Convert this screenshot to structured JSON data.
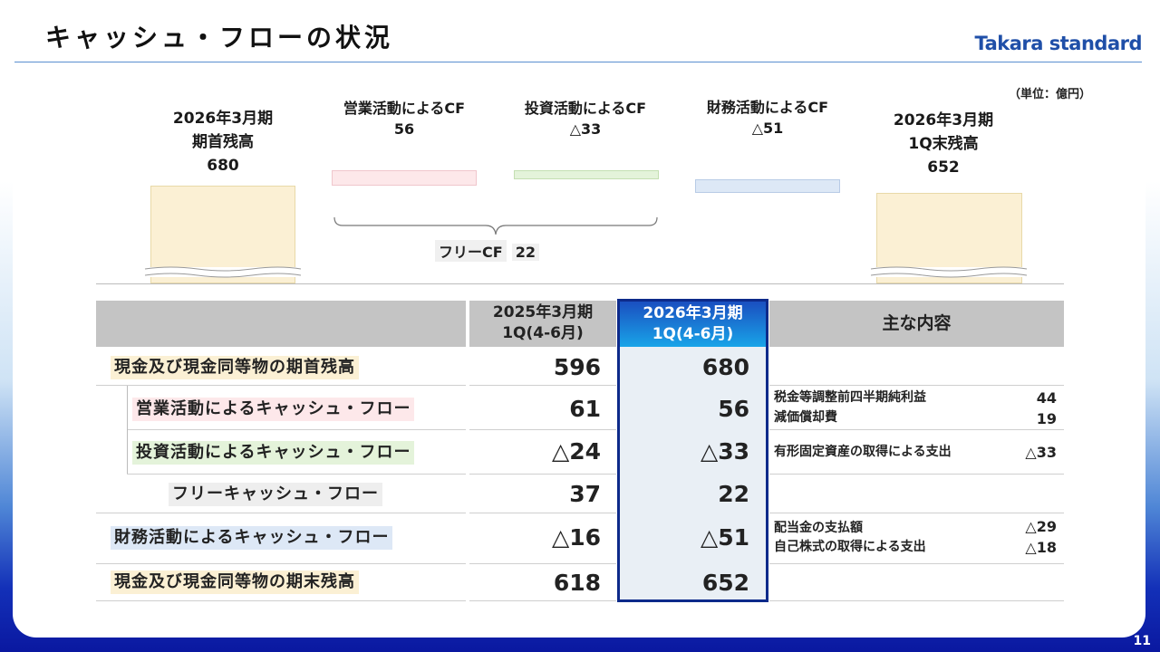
{
  "header": {
    "title": "キャッシュ・フローの状況",
    "logo": "Takara standard",
    "unit_note": "（単位：億円）"
  },
  "waterfall": {
    "opening": {
      "line1": "2026年3月期",
      "line2": "期首残高",
      "value": "680"
    },
    "operating": {
      "label": "営業活動によるCF",
      "value": "56"
    },
    "investing": {
      "label": "投資活動によるCF",
      "value": "△33"
    },
    "financing": {
      "label": "財務活動によるCF",
      "value": "△51"
    },
    "closing": {
      "line1": "2026年3月期",
      "line2": "1Q末残高",
      "value": "652"
    },
    "free_cf": {
      "label": "フリーCF",
      "value": "22"
    },
    "colors": {
      "opening": "#fbf0d4",
      "operating": "#fde8ea",
      "investing": "#e4f3da",
      "financing": "#dde8f6",
      "closing": "#fbf0d4"
    }
  },
  "table": {
    "col_prev": {
      "line1": "2025年3月期",
      "line2": "1Q(4-6月)"
    },
    "col_curr": {
      "line1": "2026年3月期",
      "line2": "1Q(4-6月)"
    },
    "col_notes": "主な内容",
    "rows": [
      {
        "label": "現金及び現金同等物の期首残高",
        "prev": "596",
        "curr": "680",
        "notes": []
      },
      {
        "label": "営業活動によるキャッシュ・フロー",
        "prev": "61",
        "curr": "56",
        "notes": [
          {
            "text": "税金等調整前四半期純利益",
            "value": "44"
          },
          {
            "text": "減価償却費",
            "value": "19"
          }
        ]
      },
      {
        "label": "投資活動によるキャッシュ・フロー",
        "prev": "△24",
        "curr": "△33",
        "notes": [
          {
            "text": "有形固定資産の取得による支出",
            "value": "△33"
          }
        ]
      },
      {
        "label": "フリーキャッシュ・フロー",
        "prev": "37",
        "curr": "22",
        "notes": []
      },
      {
        "label": "財務活動によるキャッシュ・フロー",
        "prev": "△16",
        "curr": "△51",
        "notes": [
          {
            "text": "配当金の支払額",
            "value": "△29"
          },
          {
            "text": "自己株式の取得による支出",
            "value": "△18"
          }
        ]
      },
      {
        "label": "現金及び現金同等物の期末残高",
        "prev": "618",
        "curr": "652",
        "notes": []
      }
    ]
  },
  "page_number": "11"
}
